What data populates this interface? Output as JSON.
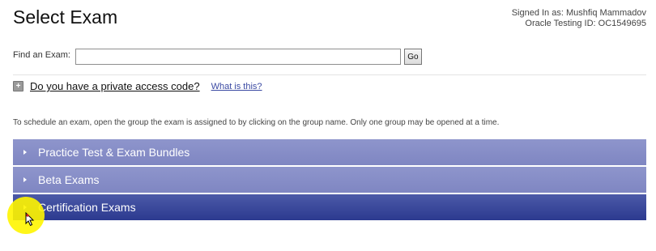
{
  "header": {
    "title": "Select Exam",
    "signed_in_line": "Signed In as: Mushfiq Mammadov",
    "testing_id_line": "Oracle Testing ID: OC1549695"
  },
  "search": {
    "label": "Find an Exam:",
    "value": "",
    "go_label": "Go"
  },
  "access": {
    "link_text": "Do you have a private access code?",
    "help_text": "What is this?"
  },
  "instructions": "To schedule an exam, open the group the exam is assigned to by clicking on the group name. Only one group may be opened at a time.",
  "groups": [
    {
      "label": "Practice Test & Exam Bundles"
    },
    {
      "label": "Beta Exams"
    },
    {
      "label": "Certification Exams"
    }
  ],
  "colors": {
    "group_bar": "#8a91c9",
    "group_bar_active": "#34418f",
    "cursor_highlight": "#fff500"
  }
}
